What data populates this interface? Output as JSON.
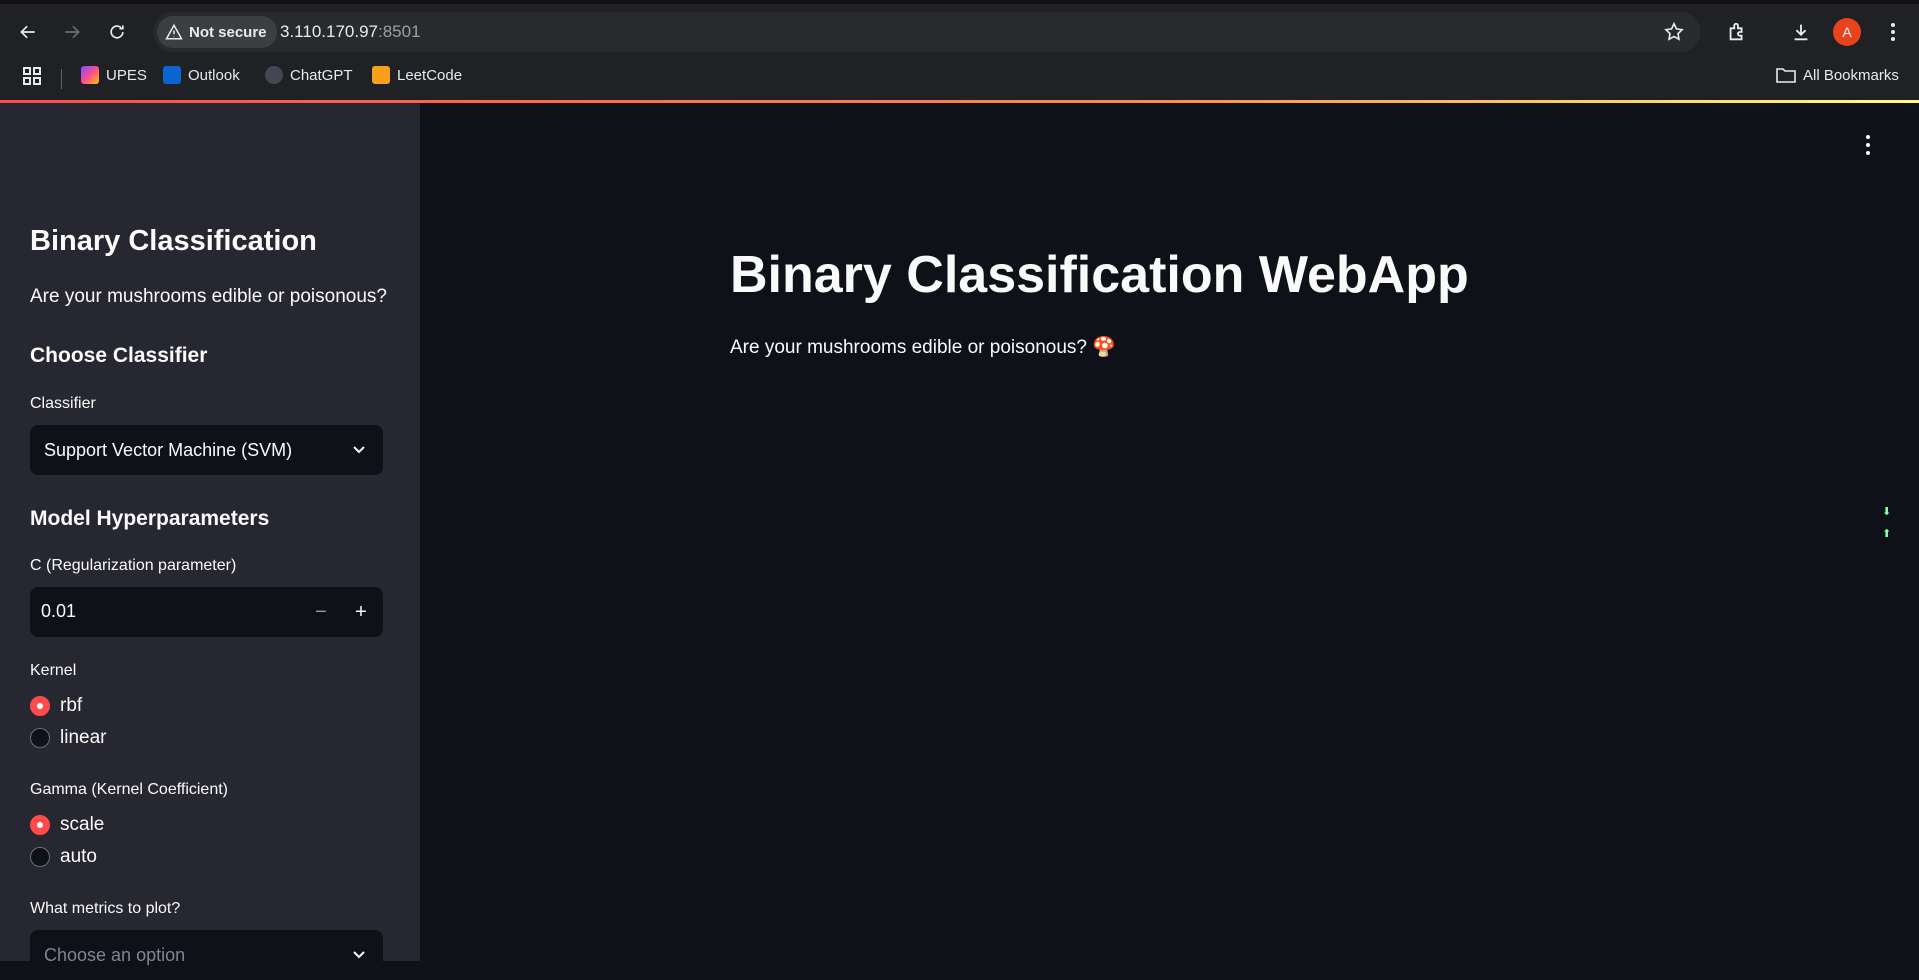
{
  "browser": {
    "security_label": "Not secure",
    "url_host": "3.110.170.97",
    "url_port": ":8501",
    "avatar_letter": "A",
    "bookmarks": [
      {
        "label": "UPES",
        "color": "#7b4dff"
      },
      {
        "label": "Outlook",
        "color": "#0a64d2"
      },
      {
        "label": "ChatGPT",
        "color": "#444654"
      },
      {
        "label": "LeetCode",
        "color": "#f89f1b"
      }
    ],
    "all_bookmarks": "All Bookmarks"
  },
  "sidebar": {
    "title": "Binary Classification",
    "subtitle": "Are your mushrooms edible or poisonous?",
    "choose_heading": "Choose Classifier",
    "classifier_label": "Classifier",
    "classifier_value": "Support Vector Machine (SVM)",
    "hyper_heading": "Model Hyperparameters",
    "c_label": "C (Regularization parameter)",
    "c_value": "0.01",
    "kernel_label": "Kernel",
    "kernel_options": [
      "rbf",
      "linear"
    ],
    "gamma_label": "Gamma (Kernel Coefficient)",
    "gamma_options": [
      "scale",
      "auto"
    ],
    "metrics_label": "What metrics to plot?",
    "metrics_placeholder": "Choose an option"
  },
  "main": {
    "title": "Binary Classification WebApp",
    "subtitle": "Are your mushrooms edible or poisonous? 🍄"
  },
  "colors": {
    "accent": "#ff4b4b",
    "sidebar_bg": "#262730",
    "main_bg": "#0e1117"
  }
}
